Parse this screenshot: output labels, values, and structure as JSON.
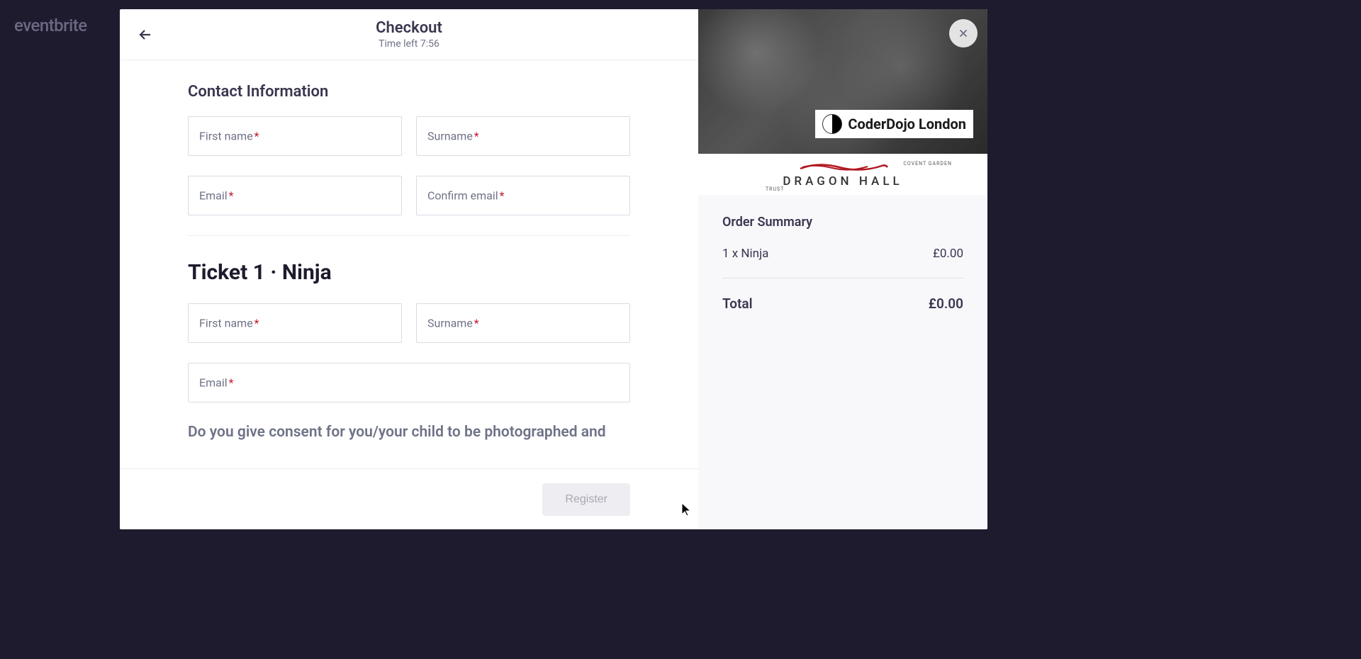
{
  "backdrop": {
    "brand": "eventbrite"
  },
  "header": {
    "title": "Checkout",
    "timer": "Time left 7:56"
  },
  "contact": {
    "section_title": "Contact Information",
    "first_name_label": "First name",
    "surname_label": "Surname",
    "email_label": "Email",
    "confirm_email_label": "Confirm email"
  },
  "ticket": {
    "title": "Ticket 1 · Ninja",
    "first_name_label": "First name",
    "surname_label": "Surname",
    "email_label": "Email",
    "consent": "Do you give consent for you/your child to be photographed and"
  },
  "footer": {
    "register_label": "Register"
  },
  "summary": {
    "title": "Order Summary",
    "item_label": "1 x Ninja",
    "item_price": "£0.00",
    "total_label": "Total",
    "total_price": "£0.00"
  },
  "branding": {
    "overlay": "CoderDojo London",
    "venue": "DRAGON HALL",
    "venue_sub": "COVENT GARDEN",
    "venue_trust": "TRUST"
  }
}
